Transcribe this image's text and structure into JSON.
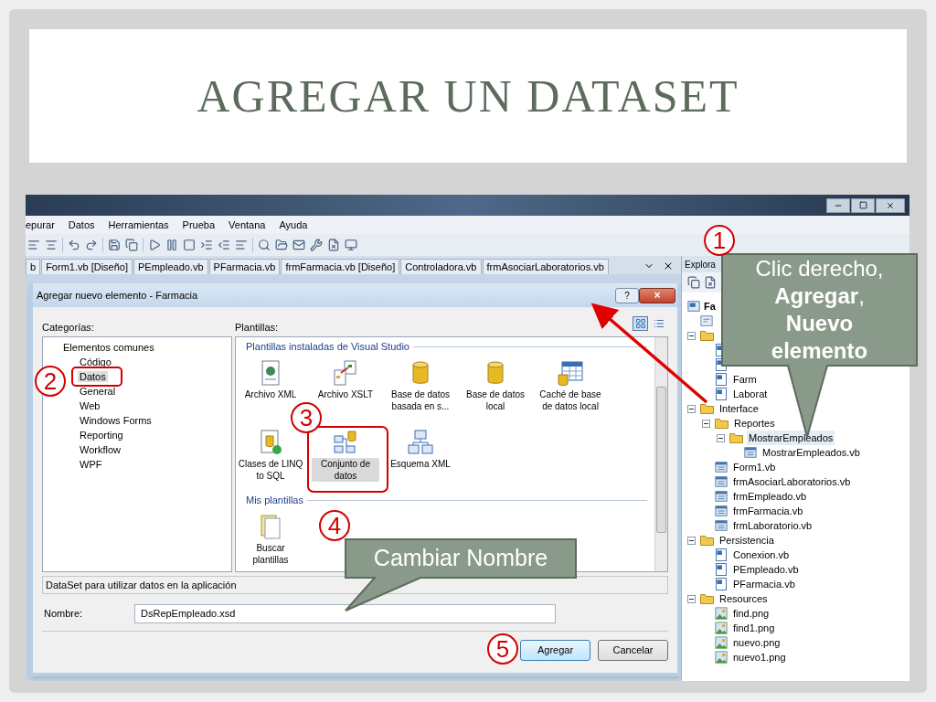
{
  "slide": {
    "title": "AGREGAR UN DATASET"
  },
  "ide": {
    "menu": [
      "epurar",
      "Datos",
      "Herramientas",
      "Prueba",
      "Ventana",
      "Ayuda"
    ],
    "tabs": [
      {
        "label": "b",
        "selected": false
      },
      {
        "label": "Form1.vb [Diseño]",
        "selected": false
      },
      {
        "label": "PEmpleado.vb",
        "selected": false
      },
      {
        "label": "PFarmacia.vb",
        "selected": false
      },
      {
        "label": "frmFarmacia.vb [Diseño]",
        "selected": false
      },
      {
        "label": "Controladora.vb",
        "selected": false
      },
      {
        "label": "frmAsociarLaboratorios.vb",
        "selected": false
      }
    ],
    "solution_explorer": {
      "title": "Explora",
      "tree": [
        {
          "label": "Fa",
          "kind": "project",
          "children": [
            {
              "kind": "settings"
            },
            {
              "kind": "folder",
              "expanded": true,
              "children": [
                {
                  "kind": "vb"
                },
                {
                  "kind": "vb"
                },
                {
                  "label": "Farm",
                  "kind": "vb"
                },
                {
                  "label": "Laborat",
                  "kind": "vb"
                }
              ]
            },
            {
              "label": "Interface",
              "kind": "folder",
              "expanded": true,
              "children": [
                {
                  "label": "Reportes",
                  "kind": "folder",
                  "expanded": true,
                  "children": [
                    {
                      "label": "MostrarEmpleados",
                      "kind": "folder",
                      "expanded": true,
                      "selected": true,
                      "children": [
                        {
                          "label": "MostrarEmpleados.vb",
                          "kind": "form",
                          "selected": false
                        }
                      ]
                    }
                  ]
                },
                {
                  "label": "Form1.vb",
                  "kind": "form"
                },
                {
                  "label": "frmAsociarLaboratorios.vb",
                  "kind": "form"
                },
                {
                  "label": "frmEmpleado.vb",
                  "kind": "form"
                },
                {
                  "label": "frmFarmacia.vb",
                  "kind": "form"
                },
                {
                  "label": "frmLaboratorio.vb",
                  "kind": "form"
                }
              ]
            },
            {
              "label": "Persistencia",
              "kind": "folder",
              "expanded": true,
              "children": [
                {
                  "label": "Conexion.vb",
                  "kind": "vb"
                },
                {
                  "label": "PEmpleado.vb",
                  "kind": "vb"
                },
                {
                  "label": "PFarmacia.vb",
                  "kind": "vb"
                }
              ]
            },
            {
              "label": "Resources",
              "kind": "folder",
              "expanded": true,
              "children": [
                {
                  "label": "find.png",
                  "kind": "png"
                },
                {
                  "label": "find1.png",
                  "kind": "png"
                },
                {
                  "label": "nuevo.png",
                  "kind": "png"
                },
                {
                  "label": "nuevo1.png",
                  "kind": "png"
                }
              ]
            }
          ]
        }
      ]
    }
  },
  "dialog": {
    "title": "Agregar nuevo elemento - Farmacia",
    "help_button": "?",
    "close_button": "×",
    "categories_label": "Categorías:",
    "categories": [
      {
        "label": "Elementos comunes",
        "children": [
          {
            "label": "Código",
            "selected": false
          },
          {
            "label": "Datos",
            "selected": true
          },
          {
            "label": "General",
            "selected": false
          },
          {
            "label": "Web",
            "selected": false
          },
          {
            "label": "Windows Forms",
            "selected": false
          },
          {
            "label": "Reporting",
            "selected": false
          },
          {
            "label": "Workflow",
            "selected": false
          },
          {
            "label": "WPF",
            "selected": false
          }
        ]
      }
    ],
    "templates_label": "Plantillas:",
    "views": [
      {
        "kind": "large-icons",
        "selected": true
      },
      {
        "kind": "list",
        "selected": false
      }
    ],
    "template_groups": [
      {
        "title": "Plantillas instaladas de Visual Studio",
        "items": [
          {
            "label": "Archivo XML",
            "kind": "xml",
            "selected": false
          },
          {
            "label": "Archivo XSLT",
            "kind": "xslt",
            "selected": false
          },
          {
            "label": "Base de datos basada en s...",
            "kind": "db",
            "selected": false
          },
          {
            "label": "Base de datos local",
            "kind": "db",
            "selected": false
          },
          {
            "label": "Caché de base de datos local",
            "kind": "cache",
            "selected": false
          },
          {
            "label": "Clases de LINQ to SQL",
            "kind": "linq",
            "selected": false
          },
          {
            "label": "Conjunto de datos",
            "kind": "dataset",
            "selected": true
          },
          {
            "label": "Esquema XML",
            "kind": "schema",
            "selected": false
          }
        ]
      },
      {
        "title": "Mis plantillas",
        "items": [
          {
            "label": "Buscar plantillas",
            "kind": "search",
            "selected": false
          }
        ]
      }
    ],
    "description": "DataSet para utilizar datos en la aplicación",
    "name_label": "Nombre:",
    "name_value": "DsRepEmpleado.xsd",
    "buttons": [
      {
        "label": "Agregar",
        "default": true
      },
      {
        "label": "Cancelar",
        "default": false
      }
    ]
  },
  "annotations": {
    "steps": [
      "1",
      "2",
      "3",
      "4",
      "5"
    ],
    "callouts": [
      {
        "text": "Clic derecho, **Agregar**, **Nuevo elemento**"
      },
      {
        "text": "Cambiar Nombre"
      }
    ]
  }
}
